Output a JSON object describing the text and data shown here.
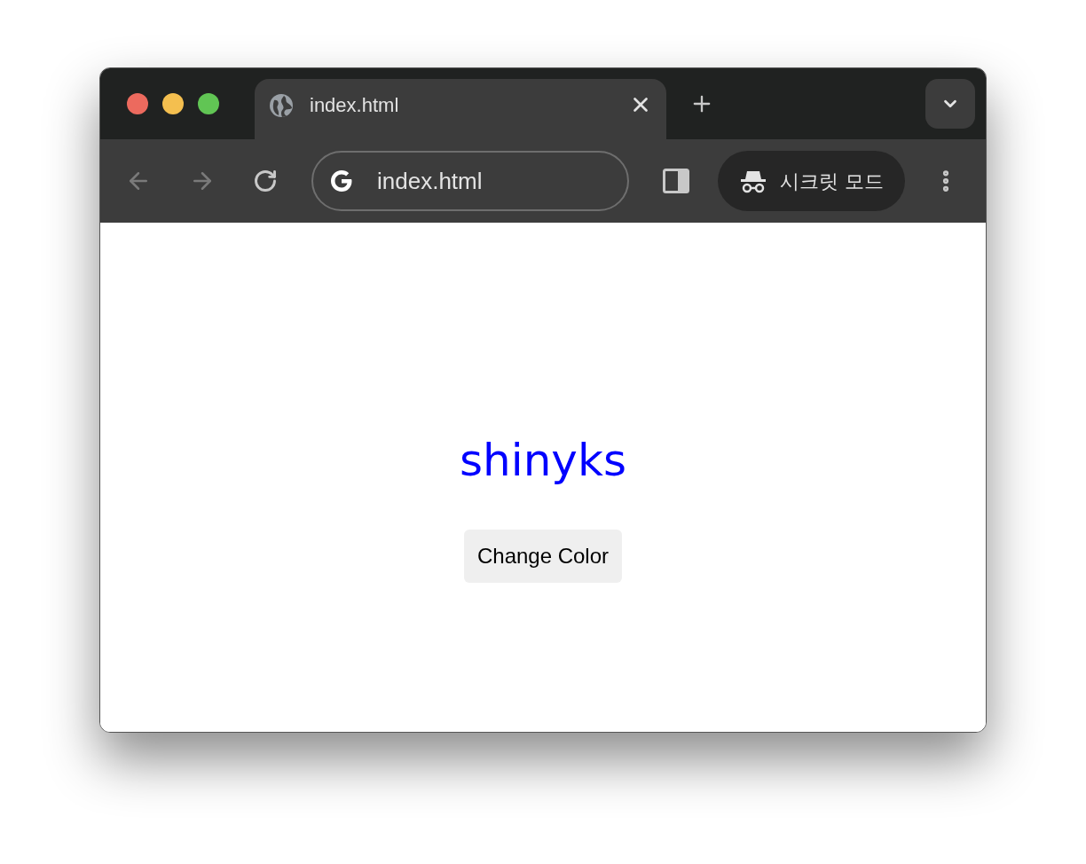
{
  "browser": {
    "tabs": [
      {
        "title": "index.html",
        "selected": true
      }
    ],
    "back": {
      "disabled": true
    },
    "forward": {
      "disabled": true
    },
    "address": "index.html",
    "incognito_label": "시크릿 모드"
  },
  "page": {
    "heading": "shinyks",
    "button": "Change Color"
  }
}
